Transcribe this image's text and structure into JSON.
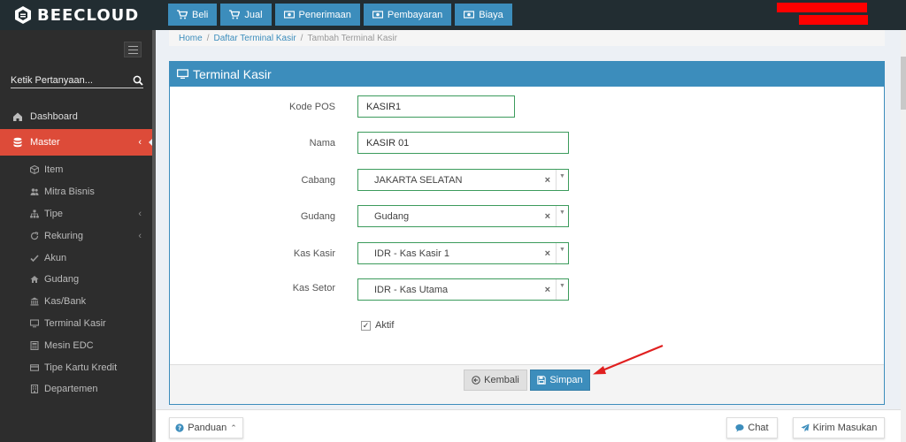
{
  "brand": {
    "name": "BEECLOUD",
    "color": "#3c8dbc"
  },
  "topnav": [
    {
      "label": "Beli",
      "icon": "cart-icon"
    },
    {
      "label": "Jual",
      "icon": "cart-icon"
    },
    {
      "label": "Penerimaan",
      "icon": "money-icon"
    },
    {
      "label": "Pembayaran",
      "icon": "money-icon"
    },
    {
      "label": "Biaya",
      "icon": "money-icon"
    }
  ],
  "sidebar": {
    "search_label": "Ketik Pertanyaan...",
    "items": [
      {
        "label": "Dashboard",
        "icon": "dashboard-icon"
      },
      {
        "label": "Master",
        "icon": "database-icon",
        "active": true
      }
    ],
    "submenu": [
      {
        "label": "Item",
        "icon": "cube-icon"
      },
      {
        "label": "Mitra Bisnis",
        "icon": "users-icon"
      },
      {
        "label": "Tipe",
        "icon": "sitemap-icon",
        "expandable": true
      },
      {
        "label": "Rekuring",
        "icon": "refresh-icon",
        "expandable": true
      },
      {
        "label": "Akun",
        "icon": "check-icon"
      },
      {
        "label": "Gudang",
        "icon": "home-icon"
      },
      {
        "label": "Kas/Bank",
        "icon": "bank-icon"
      },
      {
        "label": "Terminal Kasir",
        "icon": "monitor-icon"
      },
      {
        "label": "Mesin EDC",
        "icon": "calculator-icon"
      },
      {
        "label": "Tipe Kartu Kredit",
        "icon": "card-icon"
      },
      {
        "label": "Departemen",
        "icon": "building-icon"
      }
    ]
  },
  "breadcrumb": {
    "home": "Home",
    "list": "Daftar Terminal Kasir",
    "current": "Tambah Terminal Kasir"
  },
  "panel": {
    "title": "Terminal Kasir",
    "fields": {
      "kode_label": "Kode POS",
      "kode_value": "KASIR1",
      "nama_label": "Nama",
      "nama_value": "KASIR 01",
      "cabang_label": "Cabang",
      "cabang_value": "JAKARTA SELATAN",
      "gudang_label": "Gudang",
      "gudang_value": "Gudang",
      "kaskasir_label": "Kas Kasir",
      "kaskasir_value": "IDR - Kas Kasir 1",
      "kassetor_label": "Kas Setor",
      "kassetor_value": "IDR - Kas Utama",
      "aktif_label": "Aktif",
      "aktif_checked": true
    },
    "back_label": "Kembali",
    "save_label": "Simpan"
  },
  "footer": {
    "guide_label": "Panduan",
    "chat_label": "Chat",
    "feedback_label": "Kirim Masukan"
  },
  "colors": {
    "accent": "#3c8dbc",
    "sidebar_active": "#dd4b39",
    "field_border": "#3c9b5c",
    "annotation": "#e02020"
  }
}
